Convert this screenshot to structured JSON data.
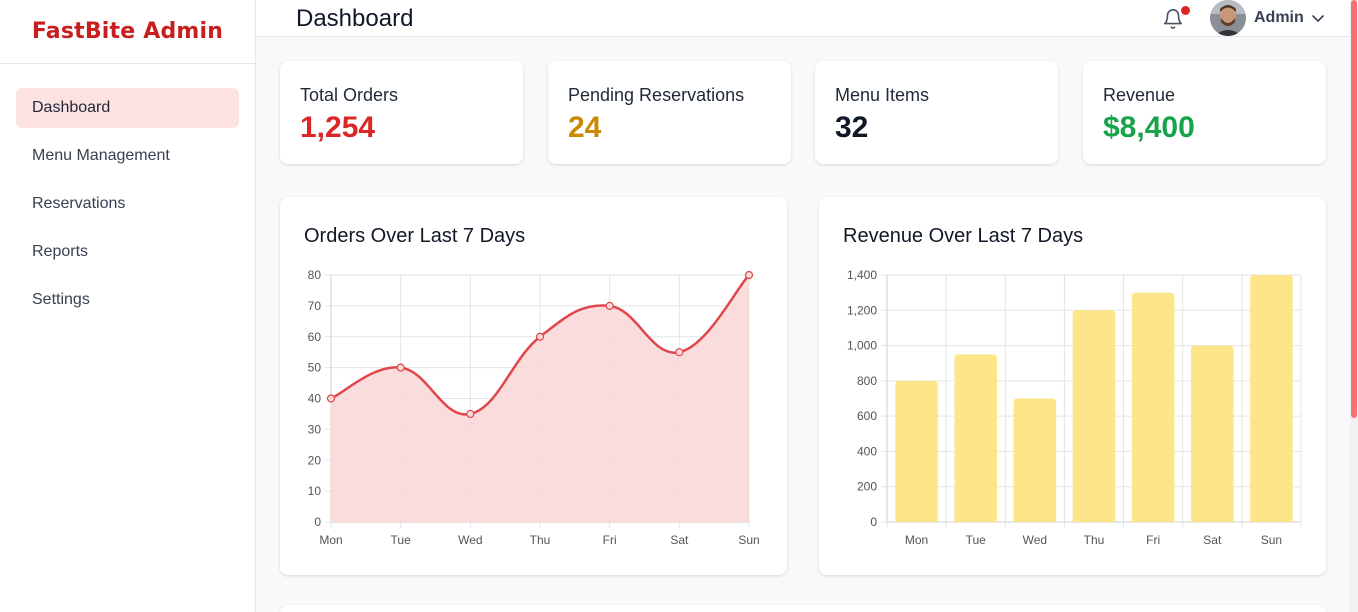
{
  "sidebar": {
    "brand": "FastBite Admin",
    "items": [
      {
        "label": "Dashboard",
        "active": true
      },
      {
        "label": "Menu Management",
        "active": false
      },
      {
        "label": "Reservations",
        "active": false
      },
      {
        "label": "Reports",
        "active": false
      },
      {
        "label": "Settings",
        "active": false
      }
    ]
  },
  "header": {
    "title": "Dashboard",
    "user": "Admin",
    "icons": [
      "bell-icon",
      "chevron-down-icon"
    ]
  },
  "stats": [
    {
      "label": "Total Orders",
      "value": "1,254",
      "color": "#dc2626"
    },
    {
      "label": "Pending Reservations",
      "value": "24",
      "color": "#ca8a04"
    },
    {
      "label": "Menu Items",
      "value": "32",
      "color": "#111827"
    },
    {
      "label": "Revenue",
      "value": "$8,400",
      "color": "#16a34a"
    }
  ],
  "colors": {
    "brand": "#c81e1e",
    "accent": "#dc2626",
    "orders_line": "#e0474c",
    "orders_fill": "#fbd8d9",
    "revenue_bar": "#fde68a"
  },
  "chart_data": [
    {
      "type": "line",
      "title": "Orders Over Last 7 Days",
      "categories": [
        "Mon",
        "Tue",
        "Wed",
        "Thu",
        "Fri",
        "Sat",
        "Sun"
      ],
      "values": [
        40,
        50,
        35,
        60,
        70,
        55,
        80
      ],
      "ylim": [
        0,
        80
      ],
      "yticks": [
        "0",
        "10",
        "20",
        "30",
        "40",
        "50",
        "60",
        "70",
        "80"
      ],
      "fill": true,
      "grid": true
    },
    {
      "type": "bar",
      "title": "Revenue Over Last 7 Days",
      "categories": [
        "Mon",
        "Tue",
        "Wed",
        "Thu",
        "Fri",
        "Sat",
        "Sun"
      ],
      "values": [
        800,
        950,
        700,
        1200,
        1300,
        1000,
        1400
      ],
      "ylim": [
        0,
        1400
      ],
      "yticks": [
        "0",
        "200",
        "400",
        "600",
        "800",
        "1,000",
        "1,200",
        "1,400"
      ],
      "grid": true
    }
  ]
}
